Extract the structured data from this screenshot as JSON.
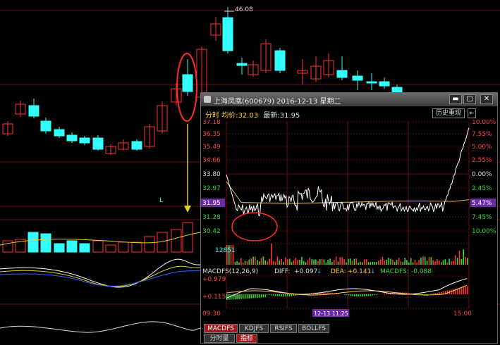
{
  "background": {
    "price_marker": "46.08",
    "k_label": "L"
  },
  "window": {
    "title": "上海凤凰(600679) 2016-12-13 星期二",
    "controls": [
      "▬",
      "▢",
      "✕"
    ]
  },
  "header": {
    "label_fenshi": "分时",
    "label_avg": "均价:",
    "avg_value": "32.03",
    "label_latest": "最新:",
    "latest_value": "31.95",
    "history_button": "历史重现",
    "back_button": "⇤"
  },
  "price_axis": {
    "left_labels": [
      "37.18",
      "36.35",
      "35.49",
      "34.66",
      "33.80",
      "32.97",
      "31.95",
      "31.28",
      "30.42"
    ],
    "right_labels": [
      "10.00%",
      "7.55%",
      "5.00%",
      "2.55%",
      "0.00%",
      "2.45%",
      "5.47%",
      "7.45%",
      "10.00%"
    ],
    "current_price": "31.95",
    "current_pct": "5.47%"
  },
  "volume": {
    "max_label": "12851"
  },
  "macd": {
    "header_name": "MACDFS(12,26,9)",
    "diff_label": "DIFF:",
    "diff_value": "+0.097",
    "dea_label": "DEA:",
    "dea_value": "+0.141",
    "macdfs_label": "MACDFS:",
    "macdfs_value": "-0.088",
    "axis_top": "+0.979",
    "axis_mid": "+0.115"
  },
  "time_axis": {
    "start": "09:30",
    "cursor": "12-13 11:25",
    "end": "15:00"
  },
  "tabs": [
    "MACDFS",
    "KDJFS",
    "RSIFS",
    "BOLLFS"
  ],
  "bottom_tabs": [
    "分时量",
    "指标"
  ],
  "colors": {
    "up": "#ff3333",
    "down": "#33ffff",
    "grid_red": "#8a1010",
    "avg_line": "#d8c060",
    "price_line": "#ffffff",
    "tab_active": "#a0191d",
    "cursor_purple": "#6a2aa8"
  }
}
